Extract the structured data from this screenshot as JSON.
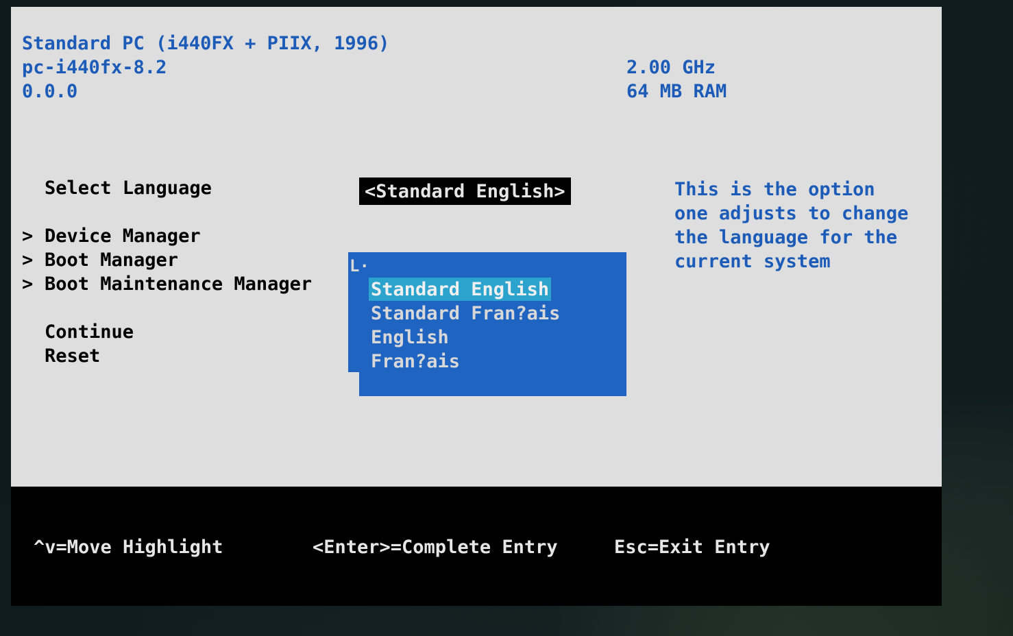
{
  "screen": {
    "background_color": "#16242A",
    "console_bg": "#DEDEDE",
    "accent_blue": "#1C5CB8",
    "popup_blue": "#1F64C0",
    "popup_highlight": "#2BA3CC",
    "statusbar_bg": "#000000"
  },
  "header": {
    "model": "Standard PC (i440FX + PIIX, 1996)",
    "board": "pc-i440fx-8.2",
    "version": "0.0.0",
    "cpu_speed": "2.00 GHz",
    "memory": "64 MB RAM"
  },
  "form": {
    "language_row": {
      "label": "Select Language",
      "value": "<Standard English>"
    },
    "menu_items": [
      {
        "arrow": ">",
        "label": "Device Manager"
      },
      {
        "arrow": ">",
        "label": "Boot Manager"
      },
      {
        "arrow": ">",
        "label": "Boot Maintenance Manager"
      }
    ],
    "actions": [
      {
        "label": "Continue"
      },
      {
        "label": "Reset"
      }
    ]
  },
  "help": {
    "text": "This is the option\none adjusts to change\nthe language for the\ncurrent system"
  },
  "dropdown": {
    "corner_glyph": "L·",
    "selected_index": 0,
    "options": [
      {
        "label": "Standard English"
      },
      {
        "label": "Standard Fran?ais"
      },
      {
        "label": "English"
      },
      {
        "label": "Fran?ais"
      }
    ]
  },
  "statusbar": {
    "keys": [
      {
        "label": "^v=Move Highlight"
      },
      {
        "label": "<Enter>=Complete Entry"
      },
      {
        "label": "Esc=Exit Entry"
      }
    ]
  }
}
